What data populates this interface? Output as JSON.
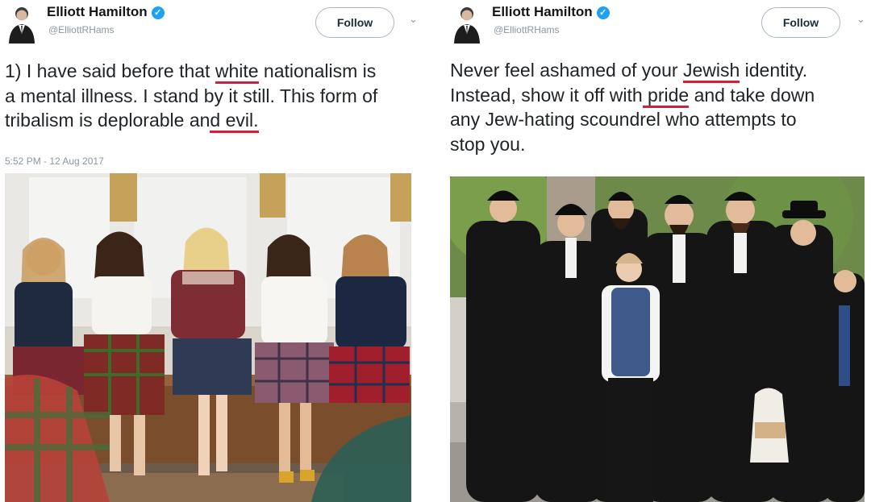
{
  "tweets": [
    {
      "author": {
        "name": "Elliott Hamilton",
        "handle": "@ElliottRHams",
        "verified_icon": "verified-badge-icon"
      },
      "follow_label": "Follow",
      "chevron_icon": "chevron-down-icon",
      "text": {
        "line1_a": "1) I have said before that ",
        "line1_hl": "white",
        "line1_b": " nationalism is",
        "line2": "a mental illness. I stand by it still. This form of",
        "line3_a": "tribalism is deplorable an",
        "line3_hl": "d evil."
      },
      "timestamp": "5:52 PM - 12 Aug 2017"
    },
    {
      "author": {
        "name": "Elliott Hamilton",
        "handle": "@ElliottRHams",
        "verified_icon": "verified-badge-icon"
      },
      "follow_label": "Follow",
      "chevron_icon": "chevron-down-icon",
      "text": {
        "line1_a": "Never feel ashamed of your ",
        "line1_hl": "Jewish",
        "line1_b": " identity.",
        "line2_a": "Instead, show it off with",
        "line2_hl": " pride",
        "line2_b": " and take down",
        "line3": "any Jew-hating scoundrel who attempts to",
        "line4": "stop you."
      }
    }
  ],
  "colors": {
    "highlight": "#d21f3c",
    "verified": "#1da1f2",
    "muted": "#8a97a3"
  }
}
